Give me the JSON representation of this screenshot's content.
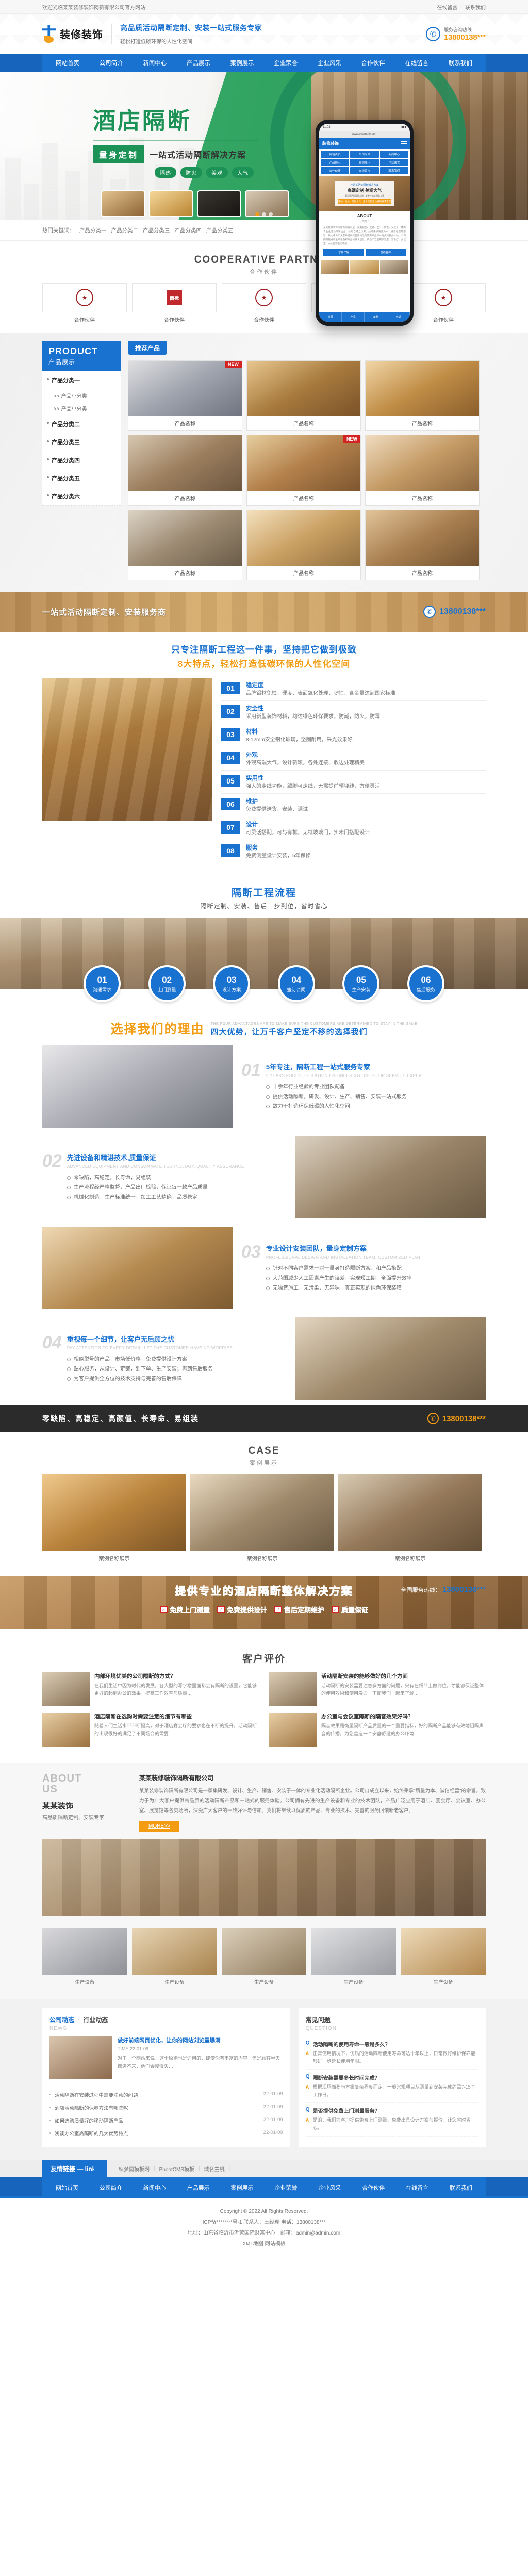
{
  "topbar": {
    "welcome": "欢迎光临某某装修装饰网新有限公司官方网站!",
    "link1": "在线留言",
    "link2": "联系我们"
  },
  "header": {
    "logo_text": "装修装饰",
    "slogan_main": "高品质活动隔断定制、安装一站式服务专家",
    "slogan_sub": "轻松打造低碳环保的人性化空间",
    "phone_label": "服务咨询热线",
    "phone_number": "13800138***"
  },
  "nav": {
    "items": [
      "网站首页",
      "公司简介",
      "新闻中心",
      "产品展示",
      "案例展示",
      "企业荣誉",
      "企业风采",
      "合作伙伴",
      "在线留言",
      "联系我们"
    ]
  },
  "hero": {
    "title": "酒店隔断",
    "badge": "量身定制",
    "subtitle": "一站式活动隔断解决方案",
    "tags": [
      "隔热",
      "防火",
      "美观",
      "大气"
    ]
  },
  "keywords": {
    "label": "热门关键词：",
    "items": [
      "产品分类一",
      "产品分类二",
      "产品分类三",
      "产品分类四",
      "产品分类五"
    ]
  },
  "partners": {
    "en": "COOPERATIVE PARTNER",
    "cn": "合作伙伴",
    "items": [
      {
        "name": "合作伙伴"
      },
      {
        "name": "合作伙伴"
      },
      {
        "name": "合作伙伴"
      },
      {
        "name": "合作伙伴"
      },
      {
        "name": "合作伙伴"
      }
    ]
  },
  "product": {
    "head_en": "PRODUCT",
    "head_cn": "产品展示",
    "categories": [
      {
        "name": "产品分类一",
        "subs": [
          ">> 产品小分类",
          ">> 产品小分类"
        ]
      },
      {
        "name": "产品分类二",
        "subs": []
      },
      {
        "name": "产品分类三",
        "subs": []
      },
      {
        "name": "产品分类四",
        "subs": []
      },
      {
        "name": "产品分类五",
        "subs": []
      },
      {
        "name": "产品分类六",
        "subs": []
      }
    ],
    "tab_label": "推荐产品",
    "badge_new": "NEW",
    "items": [
      {
        "name": "产品名称",
        "color": "linear-gradient(150deg,#e0e0e2,#9fa3ad 50%,#6f7480)"
      },
      {
        "name": "产品名称",
        "color": "linear-gradient(150deg,#e8c890,#a87a3e 50%,#7a5228)"
      },
      {
        "name": "产品名称",
        "color": "linear-gradient(150deg,#f2d7a8,#c08d46 50%,#8a5e2c)"
      },
      {
        "name": "产品名称",
        "color": "linear-gradient(150deg,#d7c7b1,#9c7f5e 50%,#6d5740)"
      },
      {
        "name": "产品名称",
        "color": "linear-gradient(150deg,#e7ce9f,#b3804a 50%,#7d5630)"
      },
      {
        "name": "产品名称",
        "color": "linear-gradient(150deg,#f0dcc0,#c49a64 50%,#8d6840)"
      },
      {
        "name": "产品名称",
        "color": "linear-gradient(150deg,#dcd4c6,#9d8b73 50%,#6a5c48)"
      },
      {
        "name": "产品名称",
        "color": "linear-gradient(150deg,#f4e1bd,#caa063 50%,#927040)"
      },
      {
        "name": "产品名称",
        "color": "linear-gradient(150deg,#e2c49a,#a87f50 50%,#745330)"
      }
    ]
  },
  "cta_bar": {
    "text": "一站式活动隔断定制、安装服务商",
    "phone": "13800138***"
  },
  "features": {
    "line1": "只专注隔断工程这一件事，坚持把它做到极致",
    "line2": "8大特点，轻松打造低碳环保的人性化空间",
    "items": [
      {
        "no": "01",
        "title": "稳定度",
        "desc": "品牌铝材免检，硬度、表面氧化处理、韧性、含金量达到国家标准"
      },
      {
        "no": "02",
        "title": "安全性",
        "desc": "采用新型装饰材料，均达绿色环保要求，防潮，防火，防霉"
      },
      {
        "no": "03",
        "title": "材料",
        "desc": "8-12mm安全钢化玻璃，坚固耐用，采光效果好"
      },
      {
        "no": "04",
        "title": "外观",
        "desc": "外观高端大气，设计新颖，各处连接、收边处理精美"
      },
      {
        "no": "05",
        "title": "实用性",
        "desc": "强大的走线功能，踢脚可走线，无需提前预埋线，方便灵活"
      },
      {
        "no": "06",
        "title": "维护",
        "desc": "免费提供送货、安装、调试"
      },
      {
        "no": "07",
        "title": "设计",
        "desc": "可灵活搭配，可与有框，无框玻璃门，实木门搭配设计"
      },
      {
        "no": "08",
        "title": "服务",
        "desc": "免费测量设计安装，5年保修"
      }
    ]
  },
  "process": {
    "title": "隔断工程流程",
    "subtitle": "隔断定制、安装、售后一步到位，省时省心",
    "steps": [
      {
        "no": "01",
        "label": "沟通需求"
      },
      {
        "no": "02",
        "label": "上门测量"
      },
      {
        "no": "03",
        "label": "设计方案"
      },
      {
        "no": "04",
        "label": "签订合同"
      },
      {
        "no": "05",
        "label": "生产安装"
      },
      {
        "no": "06",
        "label": "售后服务"
      }
    ]
  },
  "reasons": {
    "head_cn": "选择我们的理由",
    "head_en": "THE FOUR ADVANTAGES ARE TO MAKE SURE THE CUSTOMERS ARE DETERMINED TO STAY IN THE SAME",
    "head_cn2": "四大优势，让万千客户坚定不移的选择我们",
    "items": [
      {
        "no": "01",
        "title": "5年专注，隔断工程一站式服务专家",
        "en": "5 YEARS FOCUS, ISOLATION ENGINEERING ONE-STOP SERVICE EXPERT",
        "lis": [
          "十余年行业经验的专业团队配备",
          "提供活动隔断，研发、设计、生产、销售、安装一站式服务",
          "致力于打造环保低碳的人性化空间"
        ]
      },
      {
        "no": "02",
        "title": "先进设备和精湛技术,质量保证",
        "en": "ADVANCED EQUIPMENT AND CONSUMMATE TECHNOLOGY, QUALITY ASSURANCE",
        "lis": [
          "零缺陷，高稳定，长寿命，易组装",
          "生产流程经严格监督，产品出厂检验，保证每一款产品质量",
          "机械化制造，生产标准统一，加工工艺精确，品质稳定"
        ]
      },
      {
        "no": "03",
        "title": "专业设计安装团队，量身定制方案",
        "en": "PROFESSIONAL DESIGN AND INSTALLATION TEAM, CUSTOMIZED PLAN",
        "lis": [
          "针对不同客户需求一对一量身打造隔断方案、和产品搭配",
          "大范围减少人工因素产生的误差，实现短工期，全面提升效率",
          "无噪音施工，无污染，无异味，真正实现的绿色环保装璜"
        ]
      },
      {
        "no": "04",
        "title": "重视每一个细节，让客户无后顾之忧",
        "en": "PAY ATTENTION TO EVERY DETAIL, LET THE CUSTOMER HAVE NO WORRIES",
        "lis": [
          "相似型号的产品，市场低价格，免费提供设计方案",
          "贴心服务，从设计、定案，到下单、生产安装；再到售后服务",
          "为客户提供全方位的技术支持与完善的售后保障"
        ]
      }
    ]
  },
  "dark_strip": {
    "text": "零缺陷、高稳定、高颜值、长寿命、易组装",
    "phone": "13800138***"
  },
  "cases": {
    "en": "CASE",
    "cn": "案例展示",
    "items": [
      {
        "name": "案例名称展示",
        "color": "linear-gradient(150deg,#f0c98c,#b9833c 50%,#7d5526)"
      },
      {
        "name": "案例名称展示",
        "color": "linear-gradient(150deg,#e8d9c0,#a08a6c 50%,#6d5b44)"
      },
      {
        "name": "案例名称展示",
        "color": "linear-gradient(150deg,#d9cbb4,#95795a 50%,#655037)"
      }
    ]
  },
  "solution": {
    "title": "提供专业的酒店隔断整体解决方案",
    "phone_label": "全国服务热线：",
    "phone": "13800138***",
    "checks": [
      "免费上门测量",
      "免费提供设计",
      "售后定期维护",
      "质量保证"
    ]
  },
  "reviews": {
    "left_head": "客户评价",
    "right_head": "客户评价",
    "left_title": "客户评价",
    "items_left": [
      {
        "title": "内部环境优美的公司隔断的方式？",
        "desc": "在我们生活中因为时代的发展，各大型的写字楼里面都会有隔断的设置，它能够更好的起到办公的效果，提高工作效率与质量…"
      },
      {
        "title": "酒店隔断在选购时需要注意的细节有哪些",
        "desc": "随着人们生活水平不断提高，对于酒店宴会厅的要求也在不断的提升，活动隔断的出现很好的满足了不同场合的需要…"
      }
    ],
    "items_right": [
      {
        "title": "活动隔断安装的能够做好的几个方面",
        "desc": "活动隔断的安装需要注意多方面的问题，只有在细节上做到位，才能够保证整体的使用效果和使用寿命，下面我们一起来了解…"
      },
      {
        "title": "办公室与会议室隔断的隔音效果好吗？",
        "desc": "隔音效果是衡量隔断产品质量的一个重要指标，好的隔断产品能够有效地阻隔声音的传播，为您营造一个安静舒适的办公环境…"
      }
    ]
  },
  "about": {
    "en1": "ABOUT",
    "en2": "US",
    "cn": "某某装饰",
    "cn_sub": "高品质隔断定制、安装专家",
    "title": "某某装修装饰隔断有限公司",
    "paragraph": "某某装修装饰隔断有限公司是一家集研发、设计、生产、销售、安装于一体的专业化活动隔断企业。公司自成立以来，始终秉承\"质量为本、诚信经营\"的宗旨，致力于为广大客户提供高品质的活动隔断产品和一站式的服务体验。公司拥有先进的生产设备和专业的技术团队，产品广泛应用于酒店、宴会厅、会议室、办公室、展览馆等各类场所，深受广大客户的一致好评与信赖。我们将继续以优质的产品、专业的技术、完善的服务回馈新老客户。",
    "more": "MORE>>",
    "facilities": [
      {
        "name": "生产设备"
      },
      {
        "name": "生产设备"
      },
      {
        "name": "生产设备"
      },
      {
        "name": "生产设备"
      },
      {
        "name": "生产设备"
      }
    ]
  },
  "news": {
    "tab_on": "公司动态",
    "tab_off": "行业动态",
    "en": "NEWS",
    "feature": {
      "title": "做好前端网页优化，让你的网站浏览量爆满",
      "time": "TIME:22-01-09",
      "desc": "对于一个网站来说，这个原则也是适用的，即使你有丰富的内容，但是顾客半天都进不来，他们会慢慢失…"
    },
    "list": [
      {
        "title": "活动隔断在安装过程中需要注意的问题",
        "date": "22-01-09"
      },
      {
        "title": "酒店活动隔断的保养方法有哪些呢",
        "date": "22-01-09"
      },
      {
        "title": "如何选购质量好的移动隔断产品",
        "date": "22-01-09"
      },
      {
        "title": "浅谈办公室高隔断的几大优势特点",
        "date": "22-01-09"
      }
    ]
  },
  "faq": {
    "head": "常见问题",
    "en": "QUESTION",
    "items": [
      {
        "q": "活动隔断的使用寿命一般是多久？",
        "a": "正常使用情况下，优质的活动隔断使用寿命可达十年以上，日常做好维护保养能够进一步延长使用年限。"
      },
      {
        "q": "隔断安装需要多长时间完成？",
        "a": "根据现场面积与方案复杂程度而定，一般常规项目从测量到安装完成约需7-15个工作日。"
      },
      {
        "q": "是否提供免费上门测量服务？",
        "a": "是的，我们为客户提供免费上门测量、免费出具设计方案与报价，让您省时省心。"
      }
    ]
  },
  "links": {
    "tag": "友情链接 — links",
    "items": [
      "织梦园模板网",
      "PbootCMS模板",
      "域名主机"
    ]
  },
  "footer": {
    "copyright": "Copyright © 2022 All Rights Reserved.",
    "icp": "ICP备********号-1 联系人：王经理 电话：13800138***",
    "address": "地址：山东省临沂市沂蒙国际财富中心　邮箱：admin@admin.com",
    "bottom_links": "XML地图 网站模板"
  },
  "phone_mock": {
    "time": "11:03",
    "url": "www.example.com",
    "logo": "装修装饰",
    "nav": [
      "网站首页",
      "公司简介",
      "新闻中心",
      "产品展示",
      "案例展示",
      "企业荣誉",
      "合作伙伴",
      "在线留言",
      "联系我们"
    ],
    "banner_sub": "一站式活动隔断解决方案",
    "banner_title": "高端定制 美观大气",
    "banner_desc": "高品质活动隔断定制、安装一站式服务专家",
    "banner_btn": "隔热 · 防火 · 美观大气 · 量身定制活动隔断解决方案",
    "about_en": "ABOUT",
    "about_cn": "公司简介",
    "about_body": "某某装修装饰隔断有限公司是一家集研发、设计、生产、销售、安装于一体的专业化活动隔断企业。公司自成立以来，始终秉承质量为本、诚信经营的宗旨，致力于为广大客户提供高品质的活动隔断产品和一站式的服务体验。公司拥有先进的生产设备和专业的技术团队，产品广泛应用于酒店、宴会厅、会议室、办公室等各类场所。",
    "btn1": "了解详情",
    "btn2": "在线咨询",
    "tabs": [
      "首页",
      "产品",
      "案例",
      "电话"
    ]
  }
}
